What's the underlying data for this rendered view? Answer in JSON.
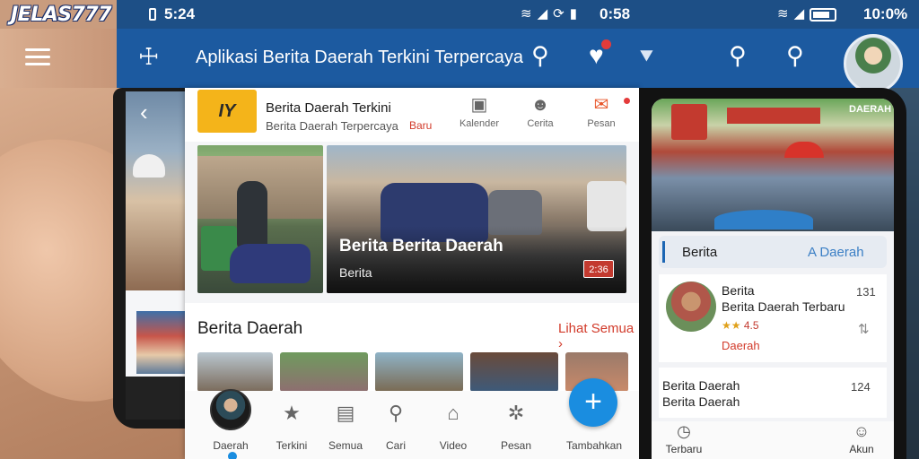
{
  "brand": "JELAS777",
  "status_bar": {
    "time_left": "5:24",
    "time_mid": "0:58",
    "time_right": "10:0%"
  },
  "app_bar": {
    "title": "Aplikasi Berita Daerah Terkini Terpercaya"
  },
  "header_card": {
    "logo_text": "IY",
    "title": "Berita Daerah Terkini",
    "subtitle": "Berita Daerah Terpercaya",
    "tag": "Baru",
    "buttons": [
      {
        "label": "Kalender"
      },
      {
        "label": "Cerita"
      },
      {
        "label": "Pesan"
      }
    ]
  },
  "featured": {
    "headline": "Berita Berita Daerah",
    "subline": "Berita",
    "badge": "2:36"
  },
  "section": {
    "title": "Berita Daerah",
    "link": "Lihat Semua"
  },
  "bottom_nav": {
    "items": [
      {
        "label": "Daerah"
      },
      {
        "label": "Terkini"
      },
      {
        "label": "Semua"
      },
      {
        "label": "Cari"
      },
      {
        "label": "Video"
      },
      {
        "label": "Pesan"
      }
    ],
    "fab_label": "Tambahkan"
  },
  "right_panel": {
    "photo_label": "DAERAH",
    "tabs": [
      "Berita",
      "A Daerah"
    ],
    "card1": {
      "title": "Berita",
      "subtitle": "Berita Daerah Terbaru",
      "rating": "4.5",
      "tag": "Daerah",
      "count": "131"
    },
    "card2": {
      "title": "Berita Daerah",
      "subtitle": "Berita Daerah",
      "count": "124"
    },
    "nav": [
      {
        "label": "Terbaru"
      },
      {
        "label": "Akun"
      }
    ]
  },
  "colors": {
    "primary": "#1c5aa0",
    "accent": "#1a8de0",
    "alert": "#d23b2b",
    "logo": "#f4b41a"
  }
}
